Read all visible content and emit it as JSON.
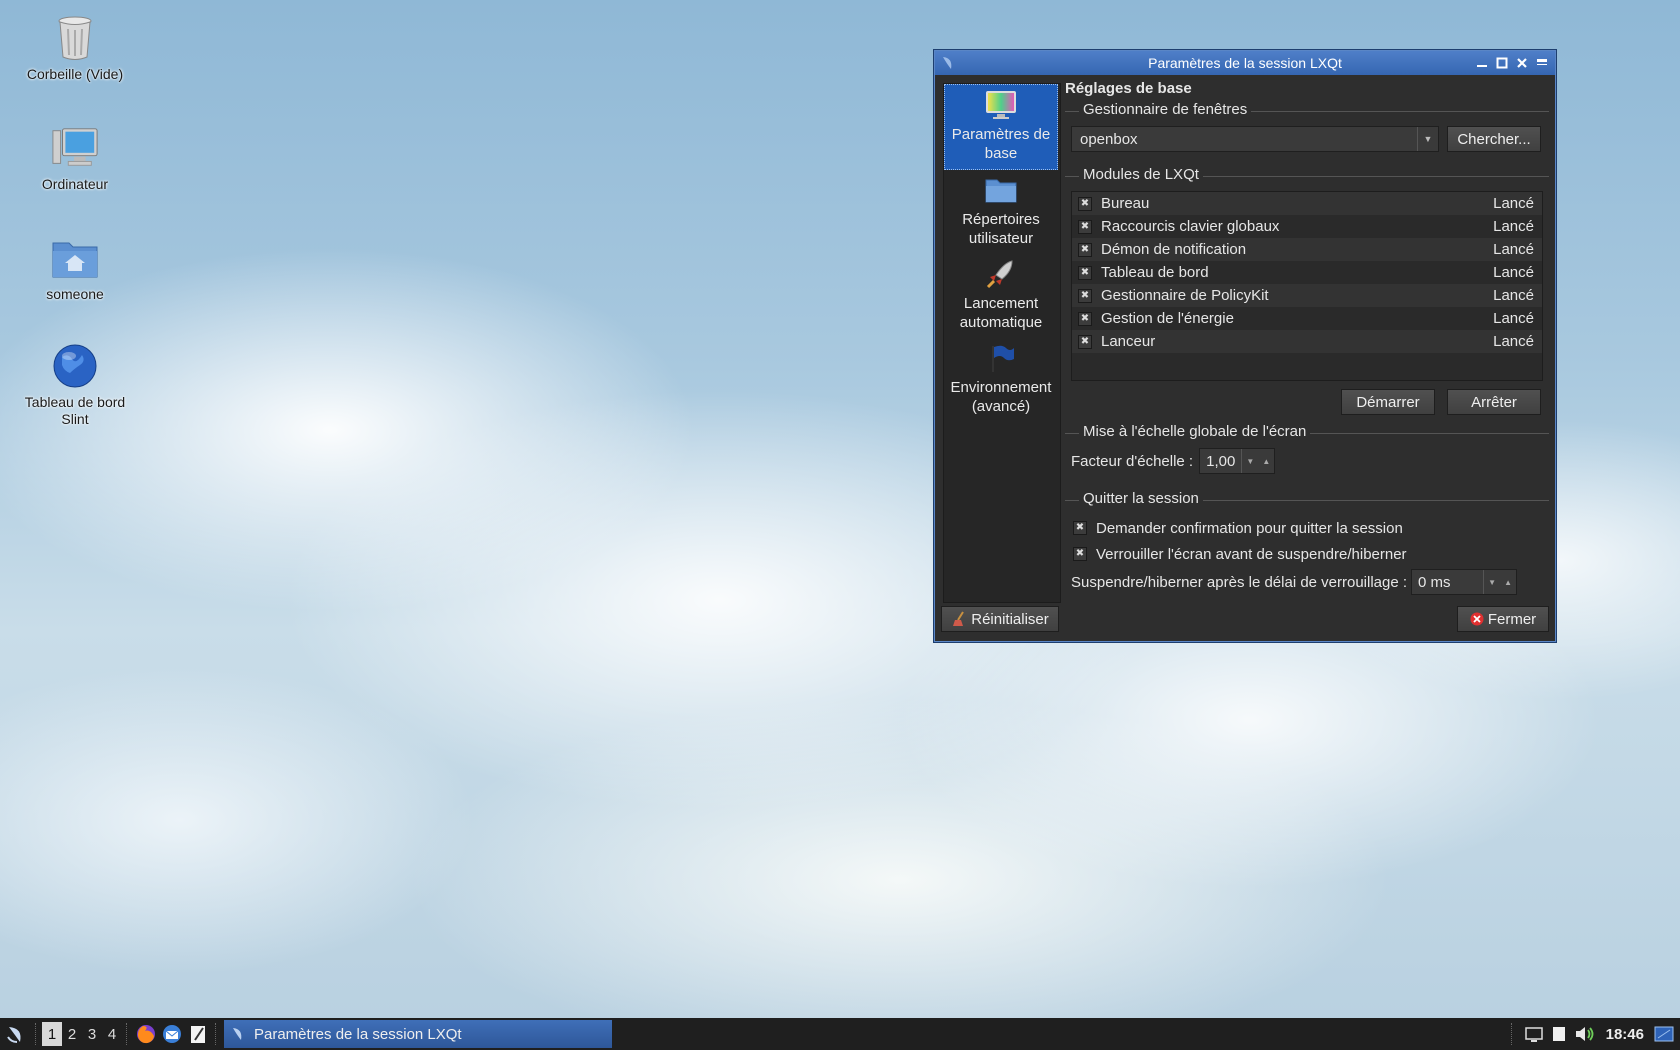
{
  "desktop": {
    "icons": [
      {
        "label": "Corbeille (Vide)",
        "icon": "trash-icon"
      },
      {
        "label": "Ordinateur",
        "icon": "computer-icon"
      },
      {
        "label": "someone",
        "icon": "home-folder-icon"
      },
      {
        "label": "Tableau de bord Slint",
        "icon": "globe-icon"
      }
    ]
  },
  "window": {
    "title": "Paramètres de la session LXQt",
    "sidebar": [
      {
        "label": "Paramètres de base",
        "icon": "monitor-icon",
        "active": true
      },
      {
        "label": "Répertoires utilisateur",
        "icon": "folder-icon",
        "active": false
      },
      {
        "label": "Lancement automatique",
        "icon": "rocket-icon",
        "active": false
      },
      {
        "label": "Environnement (avancé)",
        "icon": "flag-icon",
        "active": false
      }
    ],
    "heading": "Réglages de base",
    "wm_group": {
      "title": "Gestionnaire de fenêtres",
      "value": "openbox",
      "search_label": "Chercher..."
    },
    "modules_group": {
      "title": "Modules de LXQt",
      "modules": [
        {
          "name": "Bureau",
          "state": "Lancé",
          "checked": true
        },
        {
          "name": "Raccourcis clavier globaux",
          "state": "Lancé",
          "checked": true
        },
        {
          "name": "Démon de notification",
          "state": "Lancé",
          "checked": true
        },
        {
          "name": "Tableau de bord",
          "state": "Lancé",
          "checked": true
        },
        {
          "name": "Gestionnaire de PolicyKit",
          "state": "Lancé",
          "checked": true
        },
        {
          "name": "Gestion de l'énergie",
          "state": "Lancé",
          "checked": true
        },
        {
          "name": "Lanceur",
          "state": "Lancé",
          "checked": true
        }
      ],
      "start_label": "Démarrer",
      "stop_label": "Arrêter"
    },
    "scale_group": {
      "title": "Mise à l'échelle globale de l'écran",
      "label": "Facteur d'échelle :",
      "value": "1,00"
    },
    "quit_group": {
      "title": "Quitter la session",
      "confirm_label": "Demander confirmation pour quitter la session",
      "lock_label": "Verrouiller l'écran avant de suspendre/hiberner",
      "delay_label": "Suspendre/hiberner après le délai de verrouillage :",
      "delay_value": "0 ms"
    },
    "reset_label": "Réinitialiser",
    "close_label": "Fermer"
  },
  "taskbar": {
    "desktops": [
      "1",
      "2",
      "3",
      "4"
    ],
    "active_desktop": "1",
    "task_title": "Paramètres de la session LXQt",
    "clock": "18:46"
  },
  "colors": {
    "accent": "#1f5db8",
    "titlebar": "#3f70bd",
    "window_bg": "#2e2e2e",
    "taskbar_bg": "#1f1f1f"
  }
}
